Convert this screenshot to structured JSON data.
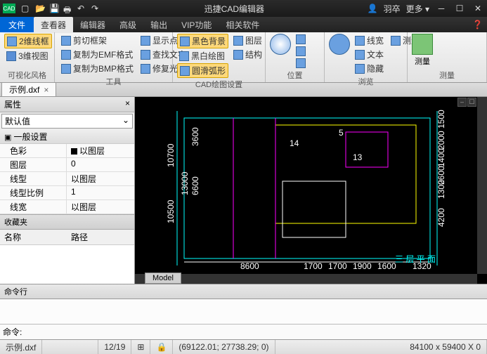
{
  "app": {
    "title": "迅捷CAD编辑器",
    "logo": "CAD"
  },
  "titlebar_right": {
    "user": "羽卒",
    "more": "更多 ▾"
  },
  "menu": {
    "file": "文件",
    "tabs": [
      "查看器",
      "编辑器",
      "高级",
      "输出",
      "VIP功能",
      "相关软件"
    ],
    "active": 0
  },
  "ribbon": {
    "g0": {
      "label": "可视化风格",
      "b0": "2维线框",
      "b1": "3维视图"
    },
    "g1": {
      "label": "工具",
      "b0": "剪切框架",
      "b1": "复制为EMF格式",
      "b2": "复制为BMP格式",
      "b3": "显示点",
      "b4": "查找文字",
      "b5": "修复光圈"
    },
    "g2": {
      "label": "CAD绘图设置",
      "b0": "黑色背景",
      "b1": "黑白绘图",
      "b2": "圆滑弧形",
      "b3": "图层",
      "b4": "结构"
    },
    "g3": {
      "label": "位置"
    },
    "g4": {
      "label": "浏览",
      "b0": "线宽",
      "b1": "测量",
      "b2": "文本",
      "b3": "隐藏"
    },
    "g5": {
      "label": "测量",
      "b0": "测量"
    }
  },
  "doc": {
    "name": "示例.dxf"
  },
  "props": {
    "title": "属性",
    "combo": "默认值",
    "cat": "一般设置",
    "rows": [
      {
        "k": "色彩",
        "v": "以图层",
        "swatch": true
      },
      {
        "k": "图层",
        "v": "0"
      },
      {
        "k": "线型",
        "v": "以图层"
      },
      {
        "k": "线型比例",
        "v": "1"
      },
      {
        "k": "线宽",
        "v": "以图层"
      }
    ]
  },
  "fav": {
    "title": "收藏夹",
    "col0": "名称",
    "col1": "路径"
  },
  "canvas": {
    "modeltab": "Model",
    "annot": "三 层 平 面",
    "dims": [
      "13000",
      "6600",
      "3600",
      "1500",
      "2000",
      "1400",
      "2600",
      "1300",
      "4200",
      "8600",
      "1700",
      "1700",
      "1900",
      "1600",
      "1320",
      "10500",
      "10700"
    ],
    "rooms": [
      "14",
      "13",
      "5"
    ]
  },
  "cmd": {
    "label": "命令行",
    "prompt": "命令:"
  },
  "status": {
    "file": "示例.dxf",
    "page": "12/19",
    "coords": "(69122.01; 27738.29; 0)",
    "size": "84100 x 59400 X 0"
  }
}
